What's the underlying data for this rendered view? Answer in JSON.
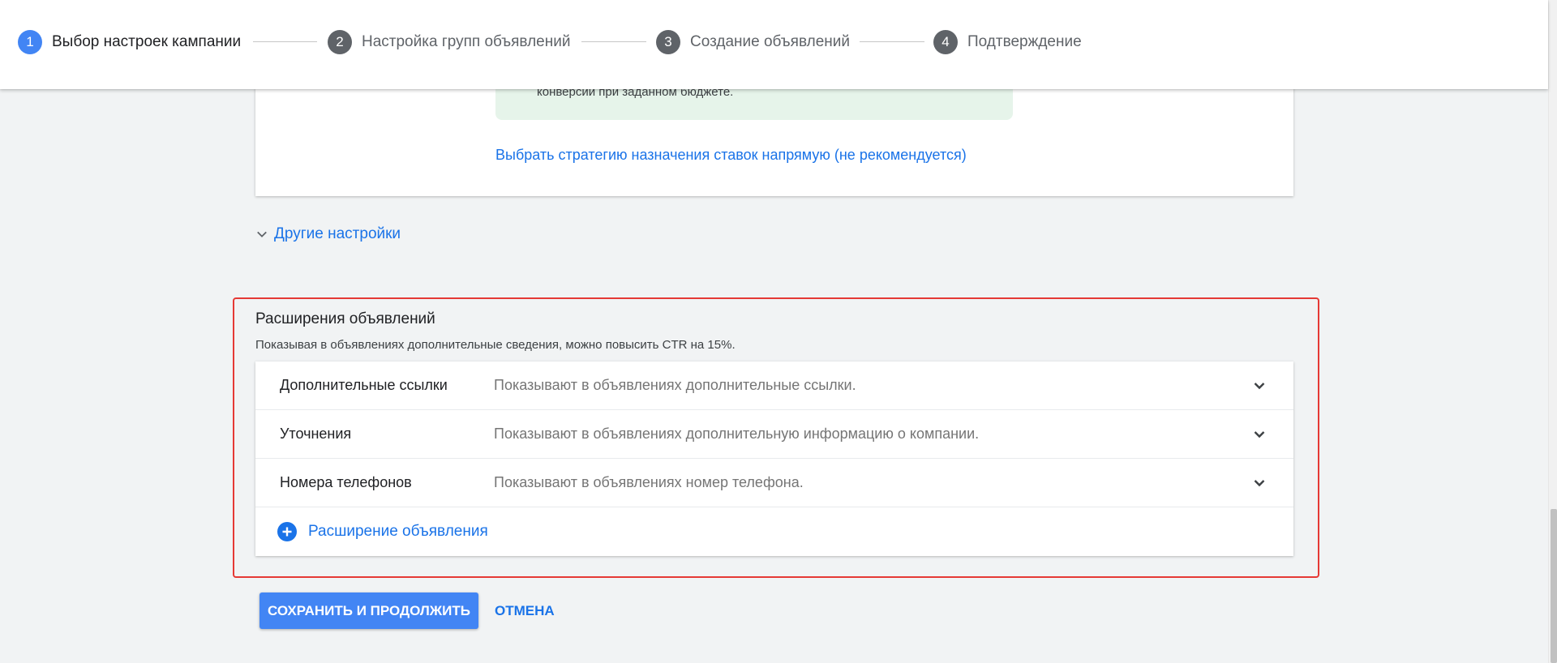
{
  "stepper": {
    "steps": [
      {
        "number": "1",
        "label": "Выбор настроек кампании",
        "active": true
      },
      {
        "number": "2",
        "label": "Настройка групп объявлений",
        "active": false
      },
      {
        "number": "3",
        "label": "Создание объявлений",
        "active": false
      },
      {
        "number": "4",
        "label": "Подтверждение",
        "active": false
      }
    ]
  },
  "bidding_card": {
    "note_text": "конверсии при заданном бюджете.",
    "direct_strategy_link": "Выбрать стратегию назначения ставок напрямую (не рекомендуется)"
  },
  "other_settings": {
    "label": "Другие настройки",
    "icon": "chevron-down-icon"
  },
  "extensions": {
    "title": "Расширения объявлений",
    "subtitle": "Показывая в объявлениях дополнительные сведения, можно повысить CTR на 15%.",
    "rows": [
      {
        "name": "Дополнительные ссылки",
        "description": "Показывают в объявлениях дополнительные ссылки."
      },
      {
        "name": "Уточнения",
        "description": "Показывают в объявлениях дополнительную информацию о компании."
      },
      {
        "name": "Номера телефонов",
        "description": "Показывают в объявлениях номер телефона."
      }
    ],
    "add_label": "Расширение объявления",
    "add_icon": "add-circle-icon",
    "highlight_color": "#e53935"
  },
  "actions": {
    "save_label": "СОХРАНИТЬ И ПРОДОЛЖИТЬ",
    "cancel_label": "ОТМЕНА"
  },
  "colors": {
    "accent": "#4285f4",
    "link": "#1a73e8",
    "note_background": "#e6f4ea"
  }
}
